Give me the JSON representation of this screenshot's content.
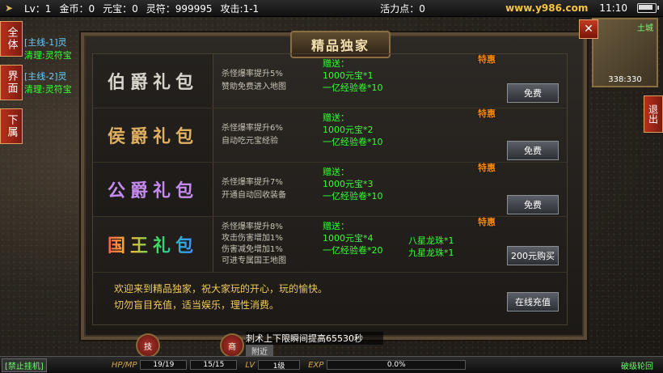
{
  "topbar": {
    "level": "Lv：1",
    "gold": "金币：0",
    "yuanbao": "元宝：0",
    "lingfu": "灵符：999995",
    "attack": "攻击:1-1",
    "vitality": "活力点：0",
    "site": "www.y986.com",
    "time": "11:10"
  },
  "sidebar": {
    "tabs": [
      "全体",
      "界面",
      "下属"
    ],
    "quests": [
      {
        "title": "[主线-1]灵",
        "sub": "清理:灵符宝"
      },
      {
        "title": "[主线-2]灵",
        "sub": "清理:灵符宝"
      }
    ]
  },
  "right": {
    "exit_label": "退出",
    "minimap_label": "土城",
    "minimap_coords": "338:330"
  },
  "modal": {
    "title": "精品独家",
    "close": "✕",
    "packages": [
      {
        "name": "伯爵礼包",
        "color": "#d8d4cc",
        "perks": [
          "杀怪爆率提升5%",
          "赞助免费进入地图"
        ],
        "gift_head": "赠送：",
        "gifts": [
          "1000元宝*1",
          "一亿经验卷*10"
        ],
        "gifts_extra": [],
        "tag": "特惠",
        "button": "免费"
      },
      {
        "name": "侯爵礼包",
        "color": "#e0b060",
        "perks": [
          "杀怪爆率提升6%",
          "自动吃元宝经验"
        ],
        "gift_head": "赠送：",
        "gifts": [
          "1000元宝*2",
          "一亿经验卷*10"
        ],
        "gifts_extra": [],
        "tag": "特惠",
        "button": "免费"
      },
      {
        "name": "公爵礼包",
        "color": "#c58af0",
        "perks": [
          "杀怪爆率提升7%",
          "开通自动回收装备"
        ],
        "gift_head": "赠送：",
        "gifts": [
          "1000元宝*3",
          "一亿经验卷*10"
        ],
        "gifts_extra": [],
        "tag": "特惠",
        "button": "免费"
      },
      {
        "name": "国王礼包",
        "color": "#66c6ff",
        "perks": [
          "杀怪爆率提升8%",
          "攻击伤害增加1%",
          "伤害减免增加1%",
          "可进专属国王地图"
        ],
        "gift_head": "赠送：",
        "gifts": [
          "1000元宝*4",
          "一亿经验卷*20"
        ],
        "gifts_extra": [
          "八星龙珠*1",
          "九星龙珠*1"
        ],
        "tag": "特惠",
        "button": "200元购买"
      }
    ],
    "footer_line1": "欢迎来到精品独家，祝大家玩的开心，玩的愉快。",
    "footer_line2": "切勿盲目充值，适当娱乐，理性消费。",
    "recharge_button": "在线充值"
  },
  "chat": {
    "text": "刺术上下限瞬间提高65530秒",
    "nearby": "附近",
    "btn_left": "技",
    "btn_right": "商"
  },
  "bottombar": {
    "hang": "[禁止挂机]",
    "hpmp_label": "HP/MP",
    "hp": "19/19",
    "mp": "15/15",
    "lv_label": "LV",
    "lv": "1级",
    "exp_label": "EXP",
    "exp": "0.0%",
    "right": "破级轮回"
  }
}
